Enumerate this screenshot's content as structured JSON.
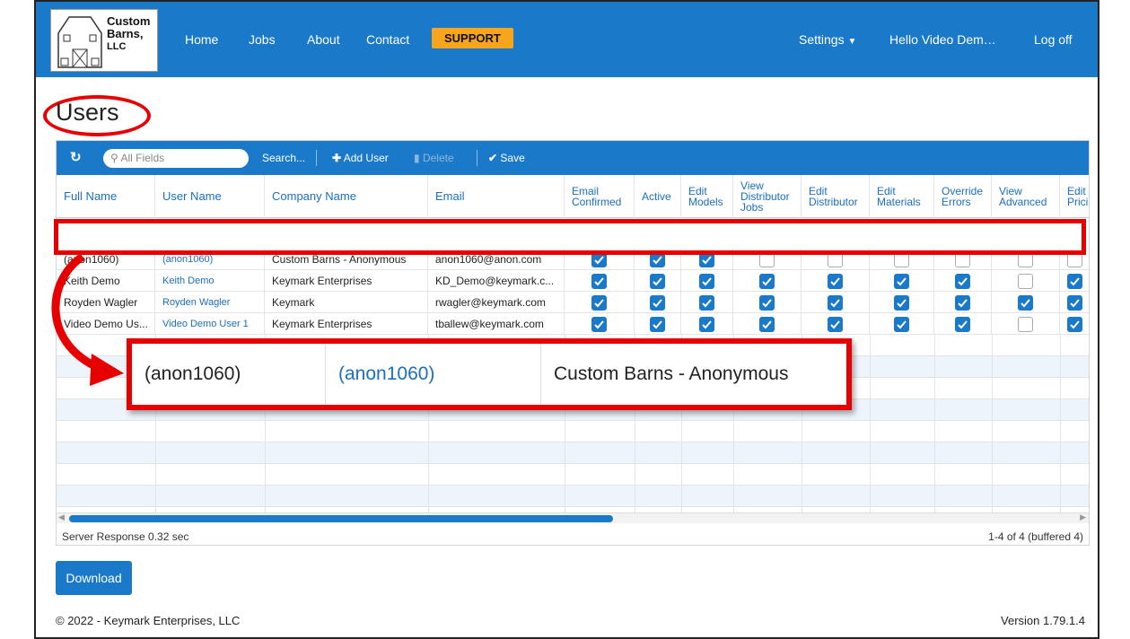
{
  "brand": {
    "logo_text_1": "Custom",
    "logo_text_2": "Barns,",
    "logo_text_3": "LLC"
  },
  "nav": {
    "home": "Home",
    "jobs": "Jobs",
    "about": "About",
    "contact": "Contact",
    "support": "SUPPORT",
    "settings": "Settings",
    "hello": "Hello Video Dem…",
    "logoff": "Log off"
  },
  "page": {
    "title": "Users"
  },
  "toolbar": {
    "search_placeholder": "All Fields",
    "search": "Search...",
    "add_user": "Add User",
    "delete": "Delete",
    "save": "Save"
  },
  "columns": {
    "full_name": "Full Name",
    "user_name": "User Name",
    "company_name": "Company Name",
    "email": "Email",
    "email_confirmed": "Email Confirmed",
    "active": "Active",
    "edit_models": "Edit Models",
    "view_distributor_jobs": "View Distributor Jobs",
    "edit_distributor": "Edit Distributor",
    "edit_materials": "Edit Materials",
    "override_errors": "Override Errors",
    "view_advanced": "View Advanced",
    "edit_pricing": "Edit Prici"
  },
  "rows": [
    {
      "full_name": "(anon1060)",
      "user_name": "(anon1060)",
      "company": "Custom Barns - Anonymous",
      "email": "anon1060@anon.com",
      "flags": [
        true,
        true,
        true,
        false,
        false,
        false,
        false,
        false,
        false
      ]
    },
    {
      "full_name": "Keith Demo",
      "user_name": "Keith Demo",
      "company": "Keymark Enterprises",
      "email": "KD_Demo@keymark.c...",
      "flags": [
        true,
        true,
        true,
        true,
        true,
        true,
        true,
        false,
        true
      ]
    },
    {
      "full_name": "Royden Wagler",
      "user_name": "Royden Wagler",
      "company": "Keymark",
      "email": "rwagler@keymark.com",
      "flags": [
        true,
        true,
        true,
        true,
        true,
        true,
        true,
        true,
        true
      ]
    },
    {
      "full_name": "Video Demo Us...",
      "user_name": "Video Demo User 1",
      "company": "Keymark Enterprises",
      "email": "tballew@keymark.com",
      "flags": [
        true,
        true,
        true,
        true,
        true,
        true,
        true,
        false,
        true
      ]
    }
  ],
  "zoom": {
    "full_name": "(anon1060)",
    "user_name": "(anon1060)",
    "company": "Custom Barns - Anonymous"
  },
  "status": {
    "server_response": "Server Response 0.32 sec",
    "paging": "1-4 of 4 (buffered 4)"
  },
  "actions": {
    "download": "Download"
  },
  "footer": {
    "copyright": "© 2022 - Keymark Enterprises, LLC",
    "version": "Version 1.79.1.4"
  },
  "colors": {
    "primary": "#1a79c8",
    "support": "#f7a51c",
    "highlight": "#e60000"
  }
}
